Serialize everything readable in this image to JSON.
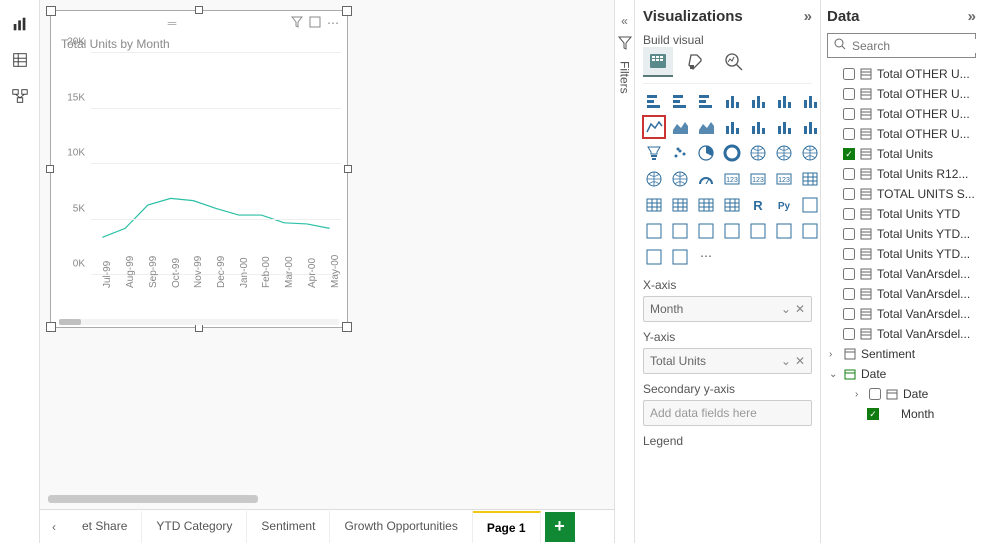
{
  "chart_data": {
    "type": "line",
    "title": "Total Units by Month",
    "xlabel": "",
    "ylabel": "",
    "ylim": [
      0,
      20000
    ],
    "y_ticks": [
      "0K",
      "5K",
      "10K",
      "15K",
      "20K"
    ],
    "categories": [
      "Jul-99",
      "Aug-99",
      "Sep-99",
      "Oct-99",
      "Nov-99",
      "Dec-99",
      "Jan-00",
      "Feb-00",
      "Mar-00",
      "Apr-00",
      "May-00"
    ],
    "values": [
      3400,
      4200,
      6300,
      6900,
      6700,
      6000,
      5400,
      5400,
      4700,
      4600,
      4200
    ]
  },
  "page_tabs": {
    "prev": "‹",
    "items": [
      "et Share",
      "YTD Category",
      "Sentiment",
      "Growth Opportunities",
      "Page 1"
    ],
    "active_index": 4,
    "add": "+"
  },
  "filters": {
    "label": "Filters"
  },
  "viz_pane": {
    "title": "Visualizations",
    "build_label": "Build visual",
    "x_axis_label": "X-axis",
    "x_axis_value": "Month",
    "y_axis_label": "Y-axis",
    "y_axis_value": "Total Units",
    "secondary_label": "Secondary y-axis",
    "secondary_placeholder": "Add data fields here",
    "legend_label": "Legend"
  },
  "data_pane": {
    "title": "Data",
    "search_placeholder": "Search",
    "fields": [
      {
        "label": "Total OTHER U...",
        "checked": false,
        "type": "measure"
      },
      {
        "label": "Total OTHER U...",
        "checked": false,
        "type": "measure"
      },
      {
        "label": "Total OTHER U...",
        "checked": false,
        "type": "measure"
      },
      {
        "label": "Total OTHER U...",
        "checked": false,
        "type": "measure"
      },
      {
        "label": "Total Units",
        "checked": true,
        "type": "measure"
      },
      {
        "label": "Total Units R12...",
        "checked": false,
        "type": "measure"
      },
      {
        "label": "TOTAL UNITS S...",
        "checked": false,
        "type": "measure"
      },
      {
        "label": "Total Units YTD",
        "checked": false,
        "type": "measure"
      },
      {
        "label": "Total Units YTD...",
        "checked": false,
        "type": "measure"
      },
      {
        "label": "Total Units YTD...",
        "checked": false,
        "type": "measure"
      },
      {
        "label": "Total VanArsdel...",
        "checked": false,
        "type": "measure"
      },
      {
        "label": "Total VanArsdel...",
        "checked": false,
        "type": "measure"
      },
      {
        "label": "Total VanArsdel...",
        "checked": false,
        "type": "measure"
      },
      {
        "label": "Total VanArsdel...",
        "checked": false,
        "type": "measure"
      }
    ],
    "groups": {
      "sentiment": "Sentiment",
      "date": "Date",
      "date_sub": "Date",
      "month": "Month"
    }
  }
}
